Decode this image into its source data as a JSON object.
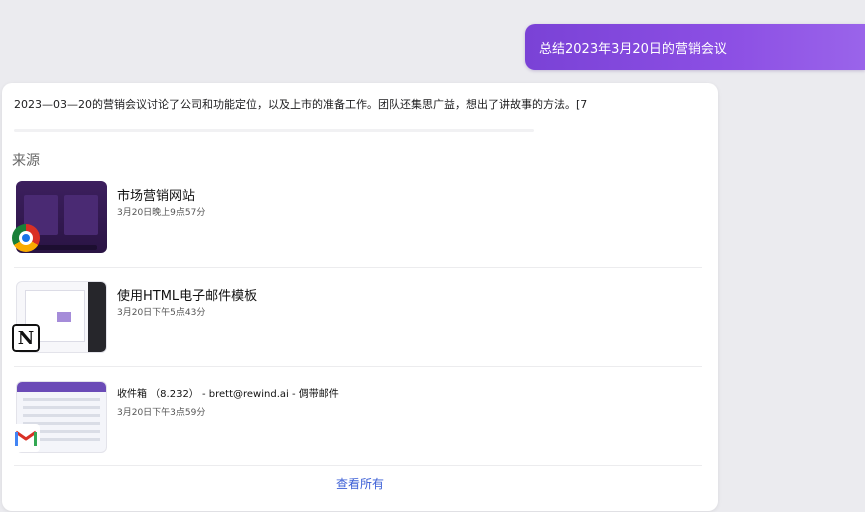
{
  "query": {
    "text": "总结2023年3月20日的营销会议"
  },
  "answer": {
    "text": "2023—03—20的营销会议讨论了公司和功能定位，以及上市的准备工作。团队还集思广益，想出了讲故事的方法。[7"
  },
  "sources": {
    "heading": "来源",
    "items": [
      {
        "title": "市场营销网站",
        "time": "3月20日晚上9点57分",
        "app_icon": "chrome-icon"
      },
      {
        "title": "使用HTML电子邮件模板",
        "time": "3月20日下午5点43分",
        "app_icon": "notion-icon"
      },
      {
        "title": "收件箱 （8.232） - brett@rewind.ai - 倜带邮件",
        "time": "3月20日下午3点59分",
        "app_icon": "gmail-icon"
      }
    ],
    "view_all_label": "查看所有"
  },
  "colors": {
    "accent_purple": "#8c4fe4",
    "link_blue": "#3a5ed6",
    "background": "#ebebef"
  }
}
